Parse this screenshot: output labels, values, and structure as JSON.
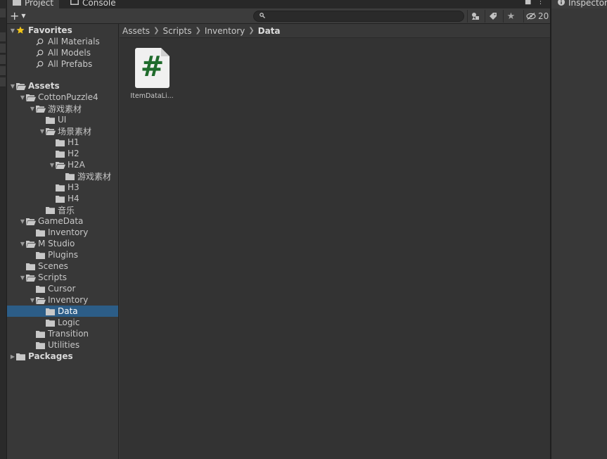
{
  "tabs": [
    {
      "label": "Project",
      "icon": "folder-icon"
    },
    {
      "label": "Console",
      "icon": "console-icon"
    }
  ],
  "inspector_tab": {
    "label": "Inspector",
    "icon": "info-icon"
  },
  "toolbar": {
    "add_label": "+",
    "search_placeholder": "",
    "hidden_count": "20"
  },
  "tree": [
    {
      "label": "Favorites",
      "depth": 0,
      "expanded": true,
      "icon": "star-icon",
      "bold": true
    },
    {
      "label": "All Materials",
      "depth": 2,
      "icon": "search-icon"
    },
    {
      "label": "All Models",
      "depth": 2,
      "icon": "search-icon"
    },
    {
      "label": "All Prefabs",
      "depth": 2,
      "icon": "search-icon"
    },
    {
      "spacer": true
    },
    {
      "label": "Assets",
      "depth": 0,
      "expanded": true,
      "icon": "folder-open-icon",
      "bold": true
    },
    {
      "label": "CottonPuzzle4",
      "depth": 1,
      "expanded": true,
      "icon": "folder-open-icon"
    },
    {
      "label": "游戏素材",
      "depth": 2,
      "expanded": true,
      "icon": "folder-open-icon"
    },
    {
      "label": "UI",
      "depth": 3,
      "icon": "folder-icon"
    },
    {
      "label": "场景素材",
      "depth": 3,
      "expanded": true,
      "icon": "folder-open-icon"
    },
    {
      "label": "H1",
      "depth": 4,
      "icon": "folder-icon"
    },
    {
      "label": "H2",
      "depth": 4,
      "icon": "folder-icon"
    },
    {
      "label": "H2A",
      "depth": 4,
      "expanded": true,
      "icon": "folder-open-icon"
    },
    {
      "label": "游戏素材",
      "depth": 5,
      "icon": "folder-icon"
    },
    {
      "label": "H3",
      "depth": 4,
      "icon": "folder-icon"
    },
    {
      "label": "H4",
      "depth": 4,
      "icon": "folder-icon"
    },
    {
      "label": "音乐",
      "depth": 3,
      "icon": "folder-icon"
    },
    {
      "label": "GameData",
      "depth": 1,
      "expanded": true,
      "icon": "folder-open-icon"
    },
    {
      "label": "Inventory",
      "depth": 2,
      "icon": "folder-icon"
    },
    {
      "label": "M Studio",
      "depth": 1,
      "expanded": true,
      "icon": "folder-open-icon"
    },
    {
      "label": "Plugins",
      "depth": 2,
      "icon": "folder-icon"
    },
    {
      "label": "Scenes",
      "depth": 1,
      "icon": "folder-icon"
    },
    {
      "label": "Scripts",
      "depth": 1,
      "expanded": true,
      "icon": "folder-open-icon"
    },
    {
      "label": "Cursor",
      "depth": 2,
      "icon": "folder-icon"
    },
    {
      "label": "Inventory",
      "depth": 2,
      "expanded": true,
      "icon": "folder-open-icon"
    },
    {
      "label": "Data",
      "depth": 3,
      "icon": "folder-icon",
      "selected": true
    },
    {
      "label": "Logic",
      "depth": 3,
      "icon": "folder-icon"
    },
    {
      "label": "Transition",
      "depth": 2,
      "icon": "folder-icon"
    },
    {
      "label": "Utilities",
      "depth": 2,
      "icon": "folder-icon"
    },
    {
      "label": "Packages",
      "depth": 0,
      "collapsed": true,
      "icon": "folder-icon",
      "bold": true
    }
  ],
  "breadcrumb": [
    "Assets",
    "Scripts",
    "Inventory",
    "Data"
  ],
  "assets": [
    {
      "name": "ItemDataLi...",
      "icon": "csharp-script-icon",
      "glyph": "#"
    }
  ],
  "colors": {
    "selection": "#2c5d87",
    "script_glyph": "#1f6b2c",
    "star": "#f0c419"
  }
}
